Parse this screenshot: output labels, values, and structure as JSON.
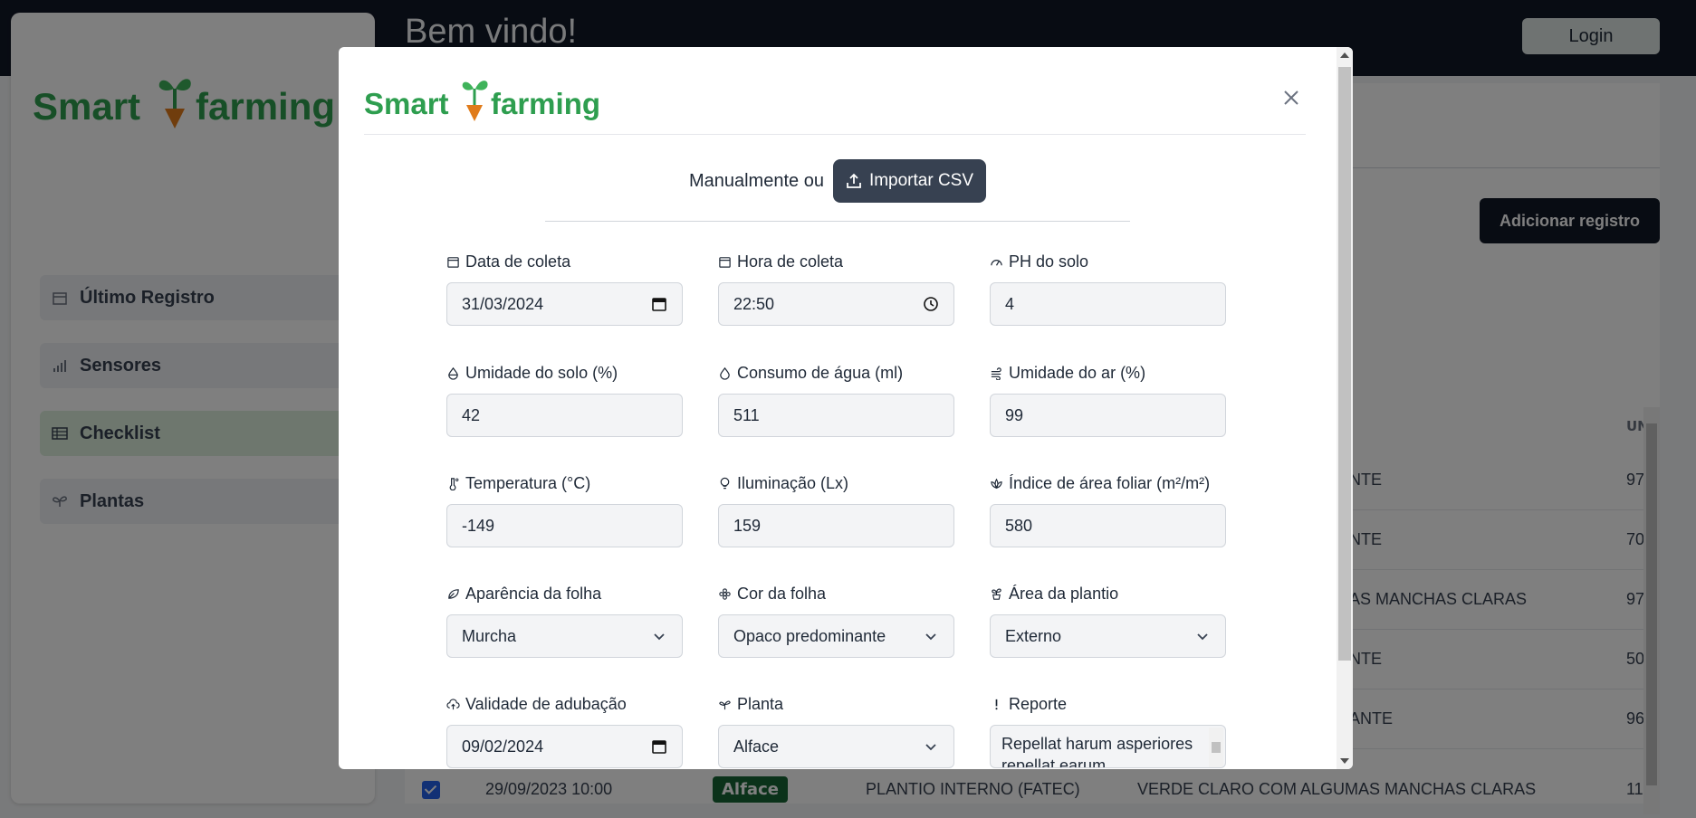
{
  "header": {
    "welcome": "Bem vindo!",
    "login_label": "Login"
  },
  "brand": {
    "name_part1": "Smart",
    "name_part2": "farming",
    "green": "#2e9e4f",
    "orange": "#e07b1a"
  },
  "sidebar": {
    "items": [
      {
        "label": "Último Registro",
        "icon": "calendar-icon"
      },
      {
        "label": "Sensores",
        "icon": "signal-icon"
      },
      {
        "label": "Checklist",
        "icon": "table-icon",
        "active": true
      },
      {
        "label": "Plantas",
        "icon": "sprout-icon"
      }
    ]
  },
  "main": {
    "add_label": "Adicionar registro",
    "table_header_partial": "UN",
    "row_fragments": [
      "NTE",
      "NTE",
      "AS MANCHAS CLARAS",
      "NTE",
      "ANTE"
    ],
    "unit_fragments": [
      "97",
      "70",
      "97",
      "50",
      "96"
    ],
    "bottom_row": {
      "datetime": "29/09/2023 10:00",
      "plant": "Alface",
      "area": "PLANTIO INTERNO (FATEC)",
      "color": "VERDE CLARO COM ALGUMAS MANCHAS CLARAS",
      "unit": "11"
    }
  },
  "modal": {
    "import_prefix": "Manualmente ou",
    "import_label": "Importar CSV",
    "fields": [
      {
        "label": "Data de coleta",
        "value": "31/03/2024",
        "icon": "calendar-icon",
        "control": "calendar-icon"
      },
      {
        "label": "Hora de coleta",
        "value": "22:50",
        "icon": "calendar-icon",
        "control": "clock-icon"
      },
      {
        "label": "PH do solo",
        "value": "4",
        "icon": "gauge-icon"
      },
      {
        "label": "Umidade do solo (%)",
        "value": "42",
        "icon": "droplet-half-icon"
      },
      {
        "label": "Consumo de água (ml)",
        "value": "511",
        "icon": "droplet-icon"
      },
      {
        "label": "Umidade do ar (%)",
        "value": "99",
        "icon": "wind-icon"
      },
      {
        "label": "Temperatura (°C)",
        "value": "-149",
        "icon": "thermometer-icon"
      },
      {
        "label": "Iluminação (Lx)",
        "value": "159",
        "icon": "lightbulb-icon"
      },
      {
        "label": "Índice de área foliar (m²/m²)",
        "value": "580",
        "icon": "lotus-icon"
      },
      {
        "label": "Aparência da folha",
        "value": "Murcha",
        "icon": "leaf-icon",
        "control": "chevron-down-icon"
      },
      {
        "label": "Cor da folha",
        "value": "Opaco predominante",
        "icon": "flower-icon",
        "control": "chevron-down-icon"
      },
      {
        "label": "Área da plantio",
        "value": "Externo",
        "icon": "plant-pot-icon",
        "control": "chevron-down-icon"
      },
      {
        "label": "Validade de adubação",
        "value": "09/02/2024",
        "icon": "cloud-upload-icon",
        "control": "calendar-icon"
      },
      {
        "label": "Planta",
        "value": "Alface",
        "icon": "sprout-icon",
        "control": "chevron-down-icon"
      },
      {
        "label": "Reporte",
        "value": "Repellat harum asperiores repellat earum",
        "icon": "exclamation-icon"
      }
    ]
  }
}
